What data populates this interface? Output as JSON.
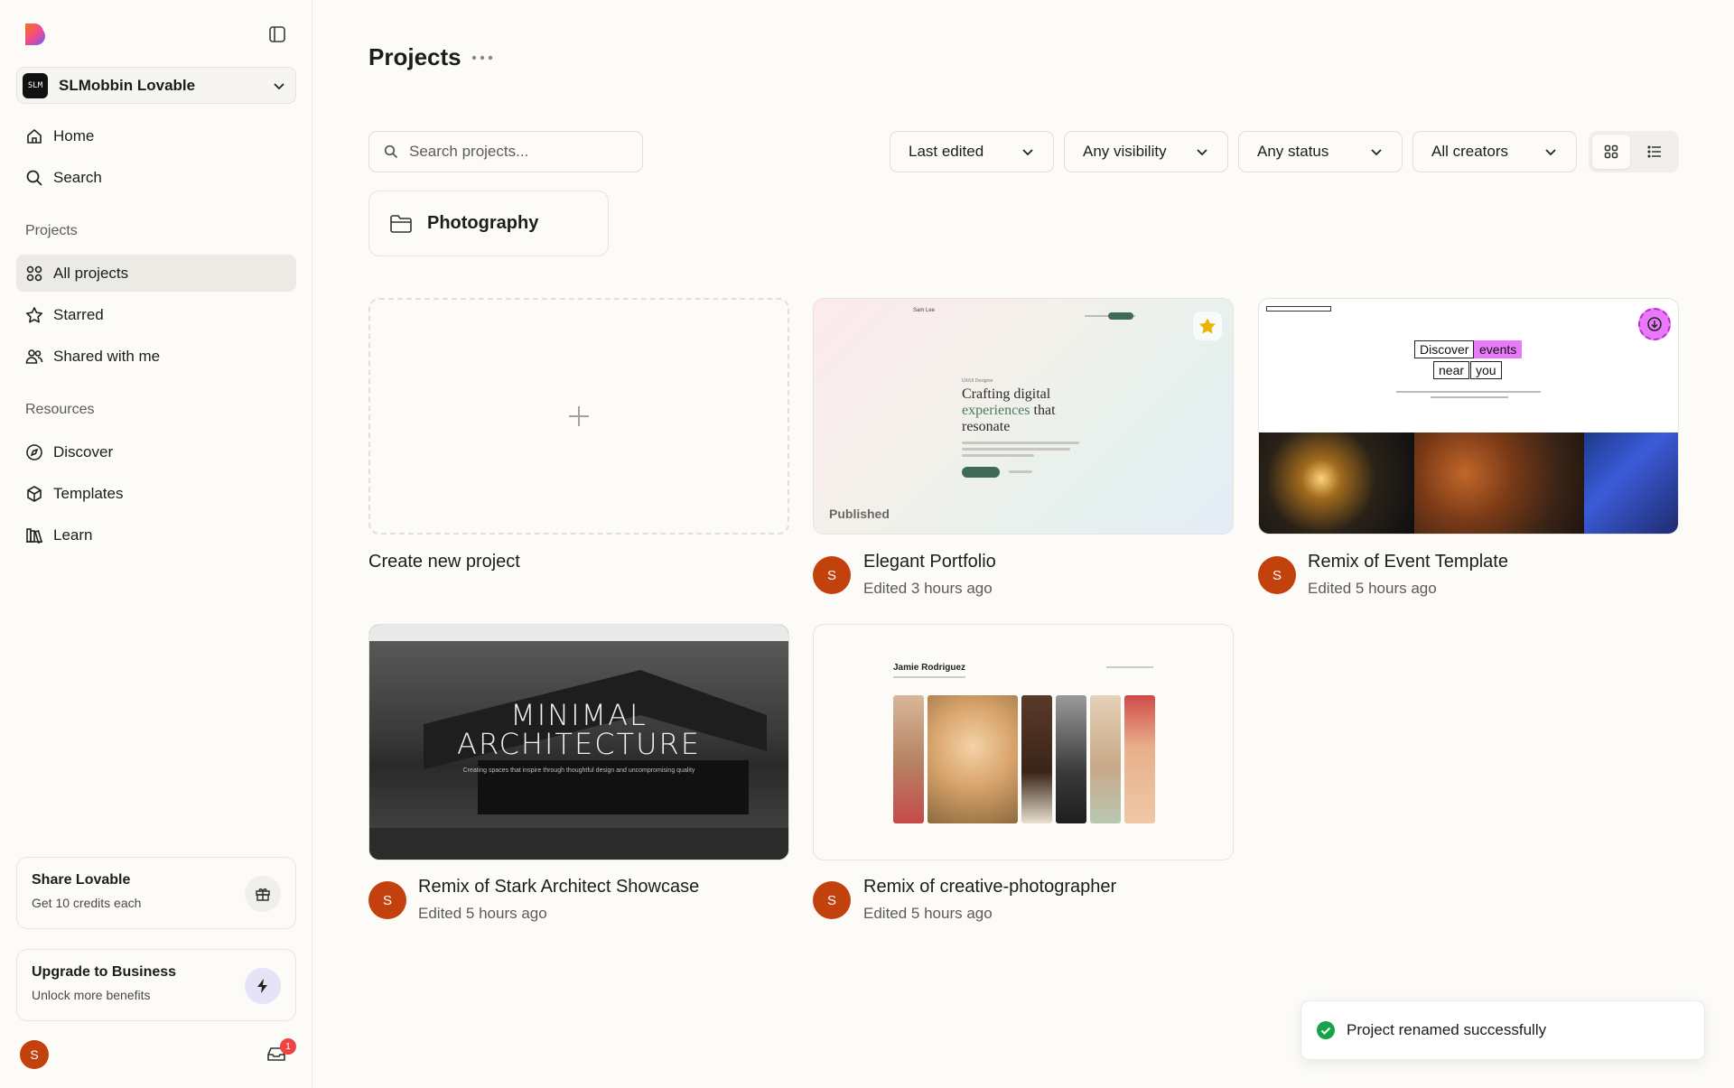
{
  "sidebar": {
    "workspace": {
      "avatar_text": "SLM",
      "name": "SLMobbin Lovable"
    },
    "nav_top": [
      {
        "label": "Home",
        "icon": "home-icon"
      },
      {
        "label": "Search",
        "icon": "search-icon"
      }
    ],
    "projects_section": "Projects",
    "projects_items": [
      {
        "label": "All projects",
        "icon": "grid-icon",
        "active": true
      },
      {
        "label": "Starred",
        "icon": "star-icon"
      },
      {
        "label": "Shared with me",
        "icon": "users-icon"
      }
    ],
    "resources_section": "Resources",
    "resources_items": [
      {
        "label": "Discover",
        "icon": "compass-icon"
      },
      {
        "label": "Templates",
        "icon": "cube-icon"
      },
      {
        "label": "Learn",
        "icon": "books-icon"
      }
    ],
    "share": {
      "title": "Share Lovable",
      "subtitle": "Get 10 credits each"
    },
    "upgrade": {
      "title": "Upgrade to Business",
      "subtitle": "Unlock more benefits"
    },
    "user_initial": "S",
    "inbox_count": "1"
  },
  "main": {
    "title": "Projects",
    "search_placeholder": "Search projects...",
    "filters": [
      "Last edited",
      "Any visibility",
      "Any status",
      "All creators"
    ],
    "folder": "Photography",
    "create_label": "Create new project",
    "projects": [
      {
        "title": "Elegant Portfolio",
        "edited": "Edited 3 hours ago",
        "badge": "Published",
        "starred": true,
        "avatar": "S"
      },
      {
        "title": "Remix of Event Template",
        "edited": "Edited 5 hours ago",
        "avatar": "S"
      },
      {
        "title": "Remix of Stark Architect Showcase",
        "edited": "Edited 5 hours ago",
        "avatar": "S"
      },
      {
        "title": "Remix of creative-photographer",
        "edited": "Edited 5 hours ago",
        "avatar": "S"
      }
    ],
    "previews": {
      "portfolio": {
        "brand": "Sam Lee",
        "eyebrow": "UX/UI Designer",
        "headline_1": "Crafting digital",
        "headline_em": "experiences",
        "headline_2": "that",
        "headline_3": "resonate"
      },
      "events": {
        "w1": "Discover",
        "w2": "events",
        "w3": "near",
        "w4": "you"
      },
      "architecture": {
        "line1": "MINIMAL",
        "line2": "ARCHITECTURE",
        "sub": "Creating spaces that inspire through thoughtful design and uncompromising quality"
      },
      "photographer": {
        "name": "Jamie Rodriguez"
      }
    }
  },
  "toast": {
    "message": "Project renamed successfully"
  },
  "colors": {
    "accent_avatar": "#c2410c",
    "events_pink": "#e879f9",
    "success": "#16a34a"
  }
}
